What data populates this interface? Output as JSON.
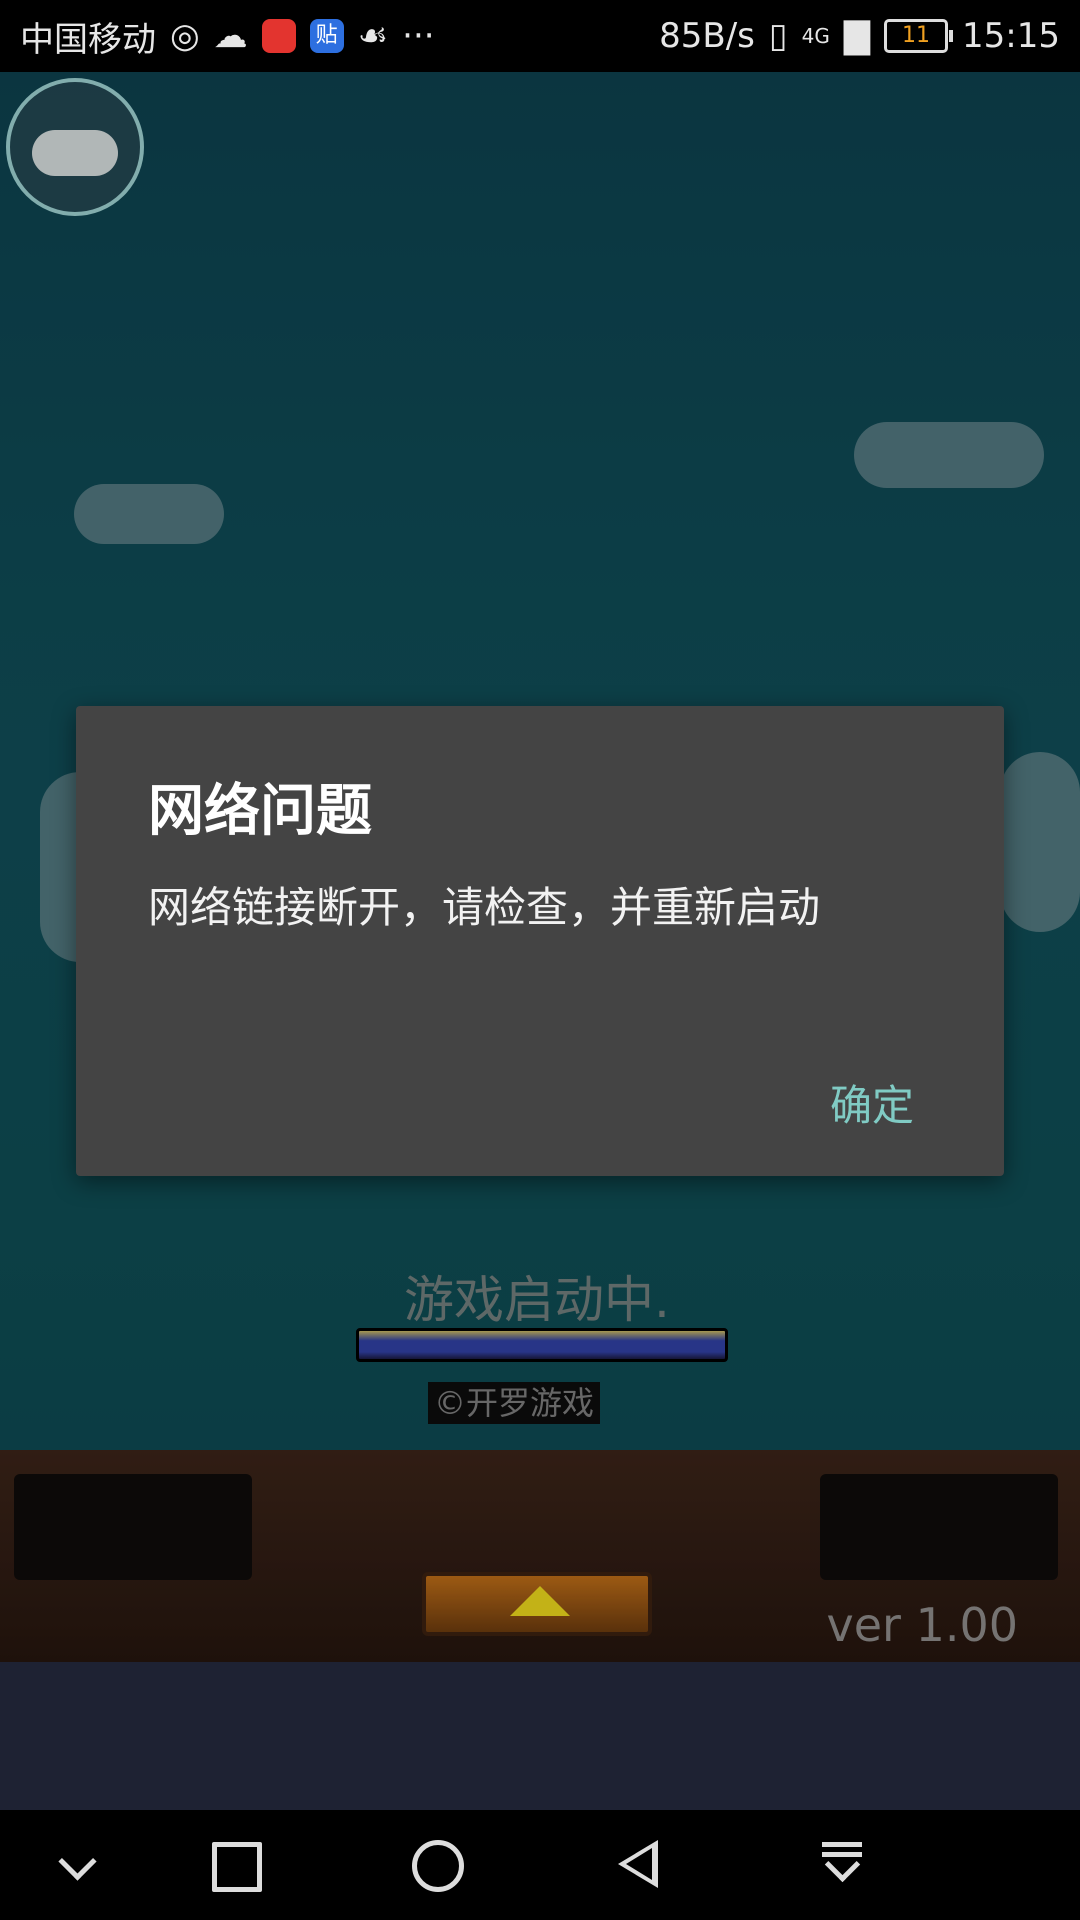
{
  "status_bar": {
    "carrier": "中国移动",
    "more": "···",
    "net_speed": "85B/s",
    "network": "4G",
    "battery": "11",
    "time": "15:15"
  },
  "game": {
    "loading_text": "游戏启动中.",
    "brand_text": "©开罗游戏",
    "version": "ver 1.00"
  },
  "dialog": {
    "title": "网络问题",
    "message": "网络链接断开，请检查，并重新启动",
    "ok_label": "确定"
  },
  "icons": {
    "gamepad": "gamepad-icon",
    "nav_down": "chevron-down-icon",
    "nav_recent": "square-icon",
    "nav_home": "circle-icon",
    "nav_back": "triangle-back-icon",
    "nav_pulldown": "pull-down-icon"
  },
  "colors": {
    "dialog_bg": "#444444",
    "ok_accent": "#80cbc4",
    "scene_bg": "#104b55"
  }
}
